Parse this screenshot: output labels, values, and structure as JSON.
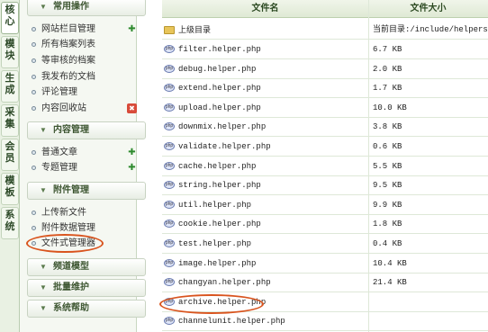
{
  "vtabs": [
    {
      "label": "核心"
    },
    {
      "label": "模块"
    },
    {
      "label": "生成"
    },
    {
      "label": "采集"
    },
    {
      "label": "会员"
    },
    {
      "label": "模板"
    },
    {
      "label": "系统"
    }
  ],
  "menu": {
    "groups": [
      {
        "label": "常用操作",
        "items": [
          {
            "label": "网站栏目管理",
            "icon": "add-icon"
          },
          {
            "label": "所有档案列表"
          },
          {
            "label": "等审核的档案"
          },
          {
            "label": "我发布的文档"
          },
          {
            "label": "评论管理"
          },
          {
            "label": "内容回收站",
            "icon": "trash-icon"
          }
        ]
      },
      {
        "label": "内容管理",
        "items": [
          {
            "label": "普通文章",
            "icon": "add-icon"
          },
          {
            "label": "专题管理",
            "icon": "add-icon"
          }
        ]
      },
      {
        "label": "附件管理",
        "items": [
          {
            "label": "上传新文件"
          },
          {
            "label": "附件数据管理"
          },
          {
            "label": "文件式管理器"
          }
        ]
      },
      {
        "label": "频道模型",
        "items": []
      },
      {
        "label": "批量维护",
        "items": []
      },
      {
        "label": "系统帮助",
        "items": []
      }
    ]
  },
  "table": {
    "headers": {
      "name": "文件名",
      "size": "文件大小"
    },
    "parent_row": {
      "name": "上级目录",
      "size": "当前目录:/include/helpers"
    },
    "rows": [
      {
        "name": "filter.helper.php",
        "size": "6.7 KB"
      },
      {
        "name": "debug.helper.php",
        "size": "2.0 KB"
      },
      {
        "name": "extend.helper.php",
        "size": "1.7 KB"
      },
      {
        "name": "upload.helper.php",
        "size": "10.0 KB"
      },
      {
        "name": "downmix.helper.php",
        "size": "3.8 KB"
      },
      {
        "name": "validate.helper.php",
        "size": "0.6 KB"
      },
      {
        "name": "cache.helper.php",
        "size": "5.5 KB"
      },
      {
        "name": "string.helper.php",
        "size": "9.5 KB"
      },
      {
        "name": "util.helper.php",
        "size": "9.9 KB"
      },
      {
        "name": "cookie.helper.php",
        "size": "1.8 KB"
      },
      {
        "name": "test.helper.php",
        "size": "0.4 KB"
      },
      {
        "name": "image.helper.php",
        "size": "10.4 KB"
      },
      {
        "name": "channelunit.helper.php",
        "size": ""
      },
      {
        "name": "changyan.helper.php",
        "size": "21.4 KB"
      },
      {
        "name": "archive.helper.php",
        "size": ""
      }
    ]
  },
  "colors": {
    "accent": "#d9541e",
    "menu_bg": "#f5f8f2",
    "header_bg": "#dfe9d4"
  }
}
